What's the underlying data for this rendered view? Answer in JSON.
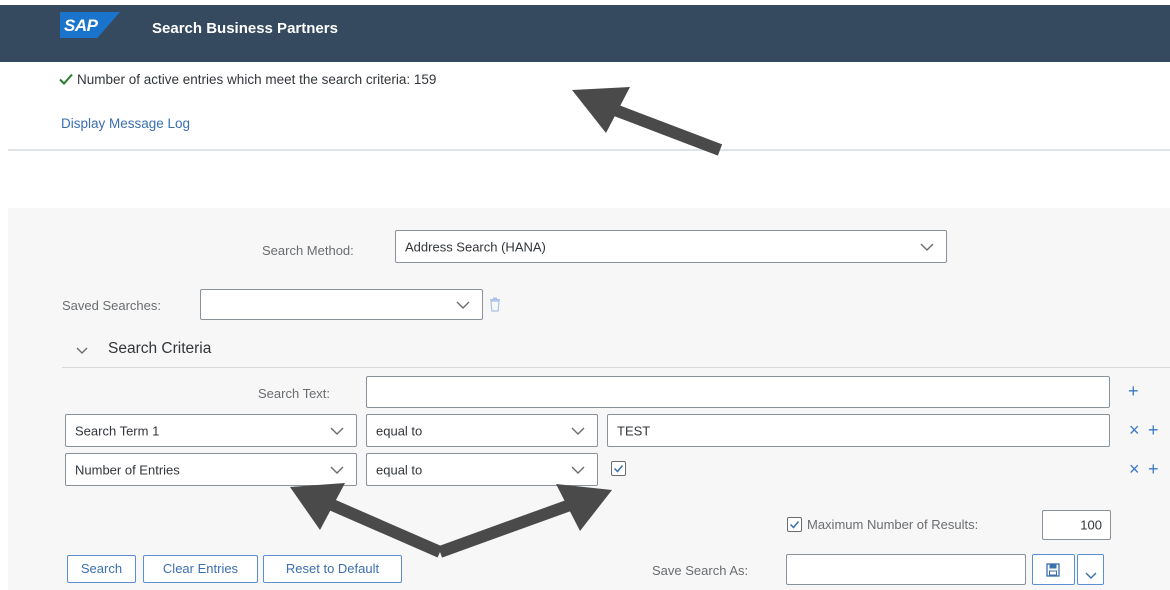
{
  "header": {
    "logo_text": "SAP",
    "title": "Search Business Partners",
    "bg_color": "#354a5f"
  },
  "message": {
    "icon": "checkmark-icon",
    "text": "Number of active entries which meet the search criteria: 159",
    "log_link": "Display Message Log"
  },
  "search_method": {
    "label": "Search Method:",
    "value": "Address Search (HANA)"
  },
  "saved_searches": {
    "label": "Saved Searches:",
    "value": "",
    "delete_icon": "trash-icon"
  },
  "criteria": {
    "title": "Search Criteria",
    "search_text": {
      "label": "Search Text:",
      "value": ""
    },
    "rows": [
      {
        "field": "Search Term 1",
        "operator": "equal to",
        "value": "TEST"
      },
      {
        "field": "Number of Entries",
        "operator": "equal to",
        "value_checked": true
      }
    ]
  },
  "max_results": {
    "label": "Maximum Number of Results:",
    "checked": true,
    "value": "100"
  },
  "buttons": {
    "search": "Search",
    "clear": "Clear Entries",
    "reset": "Reset to Default"
  },
  "save_search": {
    "label": "Save Search As:",
    "value": "",
    "save_icon": "save-icon"
  }
}
